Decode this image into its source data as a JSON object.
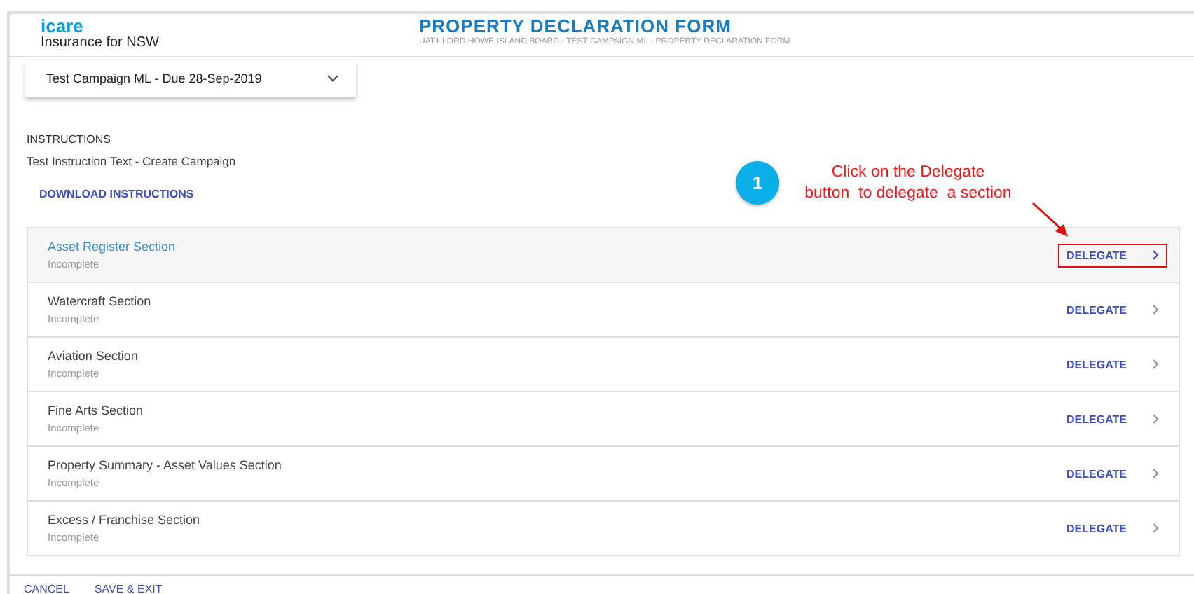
{
  "header": {
    "logo": "icare",
    "tagline": "Insurance for NSW",
    "title": "PROPERTY DECLARATION FORM",
    "subtitle": "UAT1 LORD HOWE ISLAND BOARD - TEST CAMPAIGN ML - PROPERTY DECLARATION FORM"
  },
  "campaign_select": {
    "value": "Test Campaign ML - Due 28-Sep-2019"
  },
  "instructions": {
    "heading": "INSTRUCTIONS",
    "text": "Test Instruction Text - Create Campaign",
    "link": "DOWNLOAD INSTRUCTIONS"
  },
  "sections": [
    {
      "title": "Asset Register Section",
      "status": "Incomplete",
      "action": "DELEGATE",
      "selected": true
    },
    {
      "title": "Watercraft Section",
      "status": "Incomplete",
      "action": "DELEGATE",
      "selected": false
    },
    {
      "title": "Aviation Section",
      "status": "Incomplete",
      "action": "DELEGATE",
      "selected": false
    },
    {
      "title": "Fine Arts Section",
      "status": "Incomplete",
      "action": "DELEGATE",
      "selected": false
    },
    {
      "title": "Property Summary - Asset Values Section",
      "status": "Incomplete",
      "action": "DELEGATE",
      "selected": false
    },
    {
      "title": "Excess / Franchise Section",
      "status": "Incomplete",
      "action": "DELEGATE",
      "selected": false
    }
  ],
  "callout": {
    "step": "1",
    "lines": [
      "Click on the Delegate",
      "button  to delegate  a section"
    ]
  },
  "footer": {
    "buttons": [
      "CANCEL",
      "SAVE & EXIT"
    ]
  }
}
